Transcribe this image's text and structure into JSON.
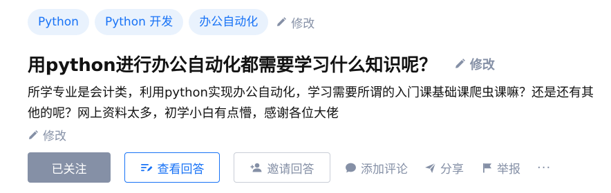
{
  "tags": [
    "Python",
    "Python 开发",
    "办公自动化"
  ],
  "tags_edit_label": "修改",
  "question": {
    "title": "用python进行办公自动化都需要学习什么知识呢？",
    "title_edit_label": "修改",
    "description": "所学专业是会计类，利用python实现办公自动化，学习需要所谓的入门课基础课爬虫课嘛？还是还有其他的呢？网上资料太多，初学小白有点懵，感谢各位大佬",
    "description_edit_label": "修改"
  },
  "actions": {
    "follow_label": "已关注",
    "view_answers_label": "查看回答",
    "invite_label": "邀请回答",
    "comment_label": "添加评论",
    "share_label": "分享",
    "report_label": "举报",
    "more_label": "···"
  },
  "icons": {
    "tag_edit": "pencil-icon",
    "title_edit": "pencil-icon",
    "desc_edit": "pencil-icon",
    "view_answers": "list-icon",
    "invite": "add-user-icon",
    "comment": "comment-bubble-icon",
    "share": "paper-plane-icon",
    "report": "flag-icon"
  },
  "colors": {
    "tag_bg": "#e9f2fd",
    "accent": "#1772f6",
    "muted": "#8590a6",
    "text": "#121212",
    "follow_bg": "#8590a6"
  }
}
